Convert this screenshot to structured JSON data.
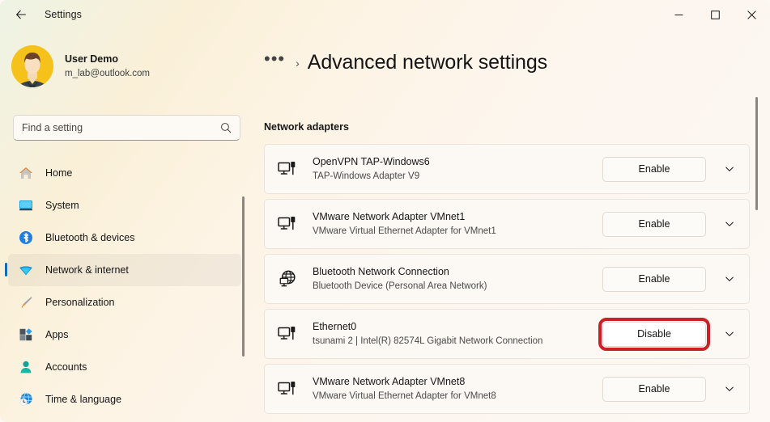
{
  "window": {
    "app_title": "Settings",
    "back_icon": "back-arrow-icon",
    "controls": {
      "minimize": "minimize-icon",
      "maximize": "maximize-icon",
      "close": "close-icon"
    }
  },
  "sidebar": {
    "account": {
      "name": "User Demo",
      "email": "m_lab@outlook.com",
      "avatar": "user-avatar"
    },
    "search": {
      "placeholder": "Find a setting",
      "value": "",
      "icon": "search-icon"
    },
    "items": [
      {
        "label": "Home",
        "icon": "home-icon",
        "selected": false
      },
      {
        "label": "System",
        "icon": "system-icon",
        "selected": false
      },
      {
        "label": "Bluetooth & devices",
        "icon": "bluetooth-icon",
        "selected": false
      },
      {
        "label": "Network & internet",
        "icon": "network-icon",
        "selected": true
      },
      {
        "label": "Personalization",
        "icon": "brush-icon",
        "selected": false
      },
      {
        "label": "Apps",
        "icon": "apps-icon",
        "selected": false
      },
      {
        "label": "Accounts",
        "icon": "accounts-icon",
        "selected": false
      },
      {
        "label": "Time & language",
        "icon": "clock-globe-icon",
        "selected": false
      }
    ]
  },
  "main": {
    "breadcrumb_overflow": "•••",
    "breadcrumb_separator": "›",
    "page_title": "Advanced network settings",
    "section_label": "Network adapters",
    "adapters": [
      {
        "name": "OpenVPN TAP-Windows6",
        "description": "TAP-Windows Adapter V9",
        "icon": "ethernet-adapter-icon",
        "action_label": "Enable",
        "highlighted": false,
        "expander_icon": "chevron-down-icon"
      },
      {
        "name": "VMware Network Adapter VMnet1",
        "description": "VMware Virtual Ethernet Adapter for VMnet1",
        "icon": "ethernet-adapter-icon",
        "action_label": "Enable",
        "highlighted": false,
        "expander_icon": "chevron-down-icon"
      },
      {
        "name": "Bluetooth Network Connection",
        "description": "Bluetooth Device (Personal Area Network)",
        "icon": "globe-adapter-icon",
        "action_label": "Enable",
        "highlighted": false,
        "expander_icon": "chevron-down-icon"
      },
      {
        "name": "Ethernet0",
        "description": "tsunami 2 | Intel(R) 82574L Gigabit Network Connection",
        "icon": "ethernet-adapter-icon",
        "action_label": "Disable",
        "highlighted": true,
        "expander_icon": "chevron-down-icon"
      },
      {
        "name": "VMware Network Adapter VMnet8",
        "description": "VMware Virtual Ethernet Adapter for VMnet8",
        "icon": "ethernet-adapter-icon",
        "action_label": "Enable",
        "highlighted": false,
        "expander_icon": "chevron-down-icon"
      }
    ]
  },
  "colors": {
    "accent": "#0f6cbd",
    "highlight_outline": "#cc2027",
    "card_background": "#fcf8f3"
  }
}
